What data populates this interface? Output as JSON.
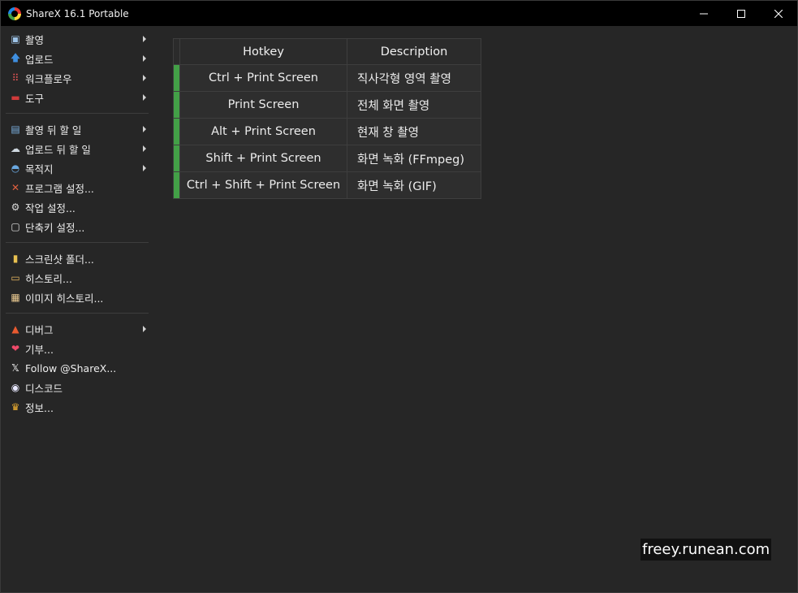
{
  "window": {
    "title": "ShareX 16.1 Portable"
  },
  "sidebar": {
    "group1": [
      {
        "label": "촬영",
        "icon": "camera-icon",
        "submenu": true
      },
      {
        "label": "업로드",
        "icon": "upload-arrow-icon",
        "submenu": true
      },
      {
        "label": "워크플로우",
        "icon": "workflow-grid-icon",
        "submenu": true
      },
      {
        "label": "도구",
        "icon": "toolbox-icon",
        "submenu": true
      }
    ],
    "group2": [
      {
        "label": "촬영 뒤 할 일",
        "icon": "after-capture-icon",
        "submenu": true
      },
      {
        "label": "업로드 뒤 할 일",
        "icon": "cloud-upload-icon",
        "submenu": true
      },
      {
        "label": "목적지",
        "icon": "destination-icon",
        "submenu": true
      },
      {
        "label": "프로그램 설정...",
        "icon": "wrench-screwdriver-icon",
        "submenu": false
      },
      {
        "label": "작업 설정...",
        "icon": "gear-icon",
        "submenu": false
      },
      {
        "label": "단축키 설정...",
        "icon": "keyboard-key-icon",
        "submenu": false
      }
    ],
    "group3": [
      {
        "label": "스크린샷 폴더...",
        "icon": "folder-icon",
        "submenu": false
      },
      {
        "label": "히스토리...",
        "icon": "history-icon",
        "submenu": false
      },
      {
        "label": "이미지 히스토리...",
        "icon": "image-history-icon",
        "submenu": false
      }
    ],
    "group4": [
      {
        "label": "디버그",
        "icon": "debug-cone-icon",
        "submenu": true
      },
      {
        "label": "기부...",
        "icon": "heart-icon",
        "submenu": false
      },
      {
        "label": "Follow @ShareX...",
        "icon": "x-logo-icon",
        "submenu": false
      },
      {
        "label": "디스코드",
        "icon": "discord-icon",
        "submenu": false
      },
      {
        "label": "정보...",
        "icon": "crown-icon",
        "submenu": false
      }
    ]
  },
  "hotkeys": {
    "headers": {
      "hotkey": "Hotkey",
      "description": "Description"
    },
    "rows": [
      {
        "hotkey": "Ctrl + Print Screen",
        "description": "직사각형 영역 촬영"
      },
      {
        "hotkey": "Print Screen",
        "description": "전체 화면 촬영"
      },
      {
        "hotkey": "Alt + Print Screen",
        "description": "현재 창 촬영"
      },
      {
        "hotkey": "Shift + Print Screen",
        "description": "화면 녹화 (FFmpeg)"
      },
      {
        "hotkey": "Ctrl + Shift + Print Screen",
        "description": "화면 녹화 (GIF)"
      }
    ],
    "status_color": "#43a047"
  },
  "watermark": "freey.runean.com"
}
